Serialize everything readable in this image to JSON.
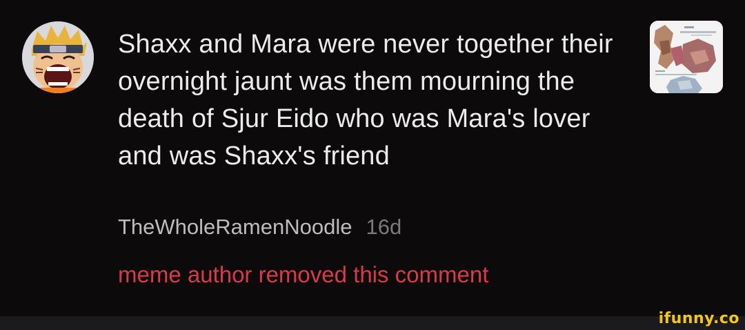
{
  "comment": {
    "text": "Shaxx and Mara were never together their overnight jaunt was them mourning the death of Sjur Eido who was Mara's lover and was Shaxx's friend",
    "username": "TheWholeRamenNoodle",
    "time": "16d",
    "removed_notice": "meme author removed this comment",
    "avatar_icon": "naruto-screaming-avatar-icon",
    "thumbnail_icon": "meme-thumbnail-icon"
  },
  "watermark": {
    "text": "ifunny.co"
  },
  "colors": {
    "background": "#0c0a0b",
    "comment_text": "#ececec",
    "username": "#bdbdbd",
    "time": "#7b7b7b",
    "removed_notice": "#d83a4a",
    "watermark": "#f4c51b"
  }
}
